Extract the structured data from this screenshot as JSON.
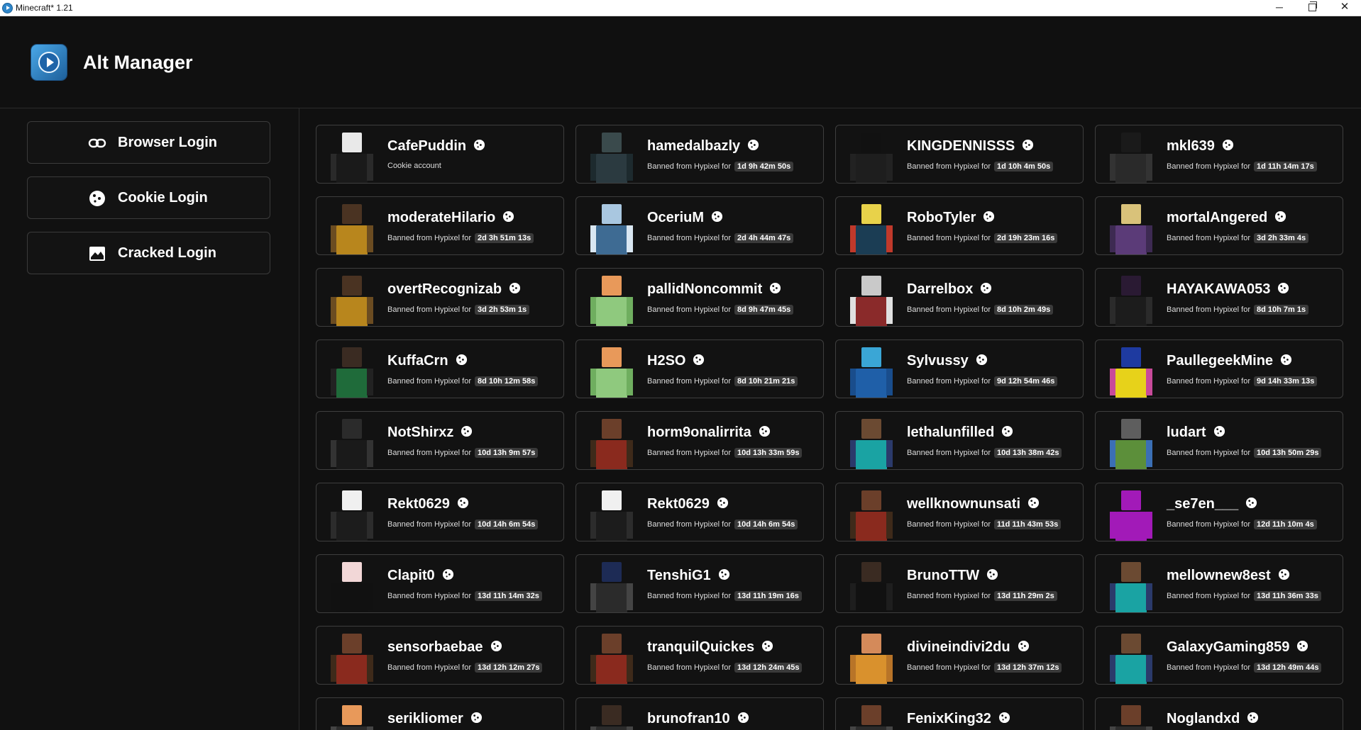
{
  "window": {
    "title": "Minecraft* 1.21",
    "controls": {
      "minimize": "─",
      "maximize": "",
      "close": "✕"
    }
  },
  "header": {
    "title": "Alt Manager",
    "logo_icon": "play-logo-icon"
  },
  "sidebar": {
    "buttons": [
      {
        "label": "Browser Login",
        "icon": "link-icon"
      },
      {
        "label": "Cookie Login",
        "icon": "cookie-icon"
      },
      {
        "label": "Cracked Login",
        "icon": "image-icon"
      }
    ]
  },
  "colors": {
    "background": "#101010",
    "card_border": "#3e3e3e",
    "badge": "#3a3a3a"
  },
  "banned_prefix": "Banned from Hypixel for",
  "accounts": [
    {
      "name": "CafePuddin",
      "status": "Cookie account",
      "duration": ""
    },
    {
      "name": "hamedalbazly",
      "status": "Banned from Hypixel for",
      "duration": "1d 9h 42m 50s"
    },
    {
      "name": "KINGDENNISSS",
      "status": "Banned from Hypixel for",
      "duration": "1d 10h 4m 50s"
    },
    {
      "name": "mkl639",
      "status": "Banned from Hypixel for",
      "duration": "1d 11h 14m 17s"
    },
    {
      "name": "moderateHilario",
      "status": "Banned from Hypixel for",
      "duration": "2d 3h 51m 13s"
    },
    {
      "name": "OceriuM",
      "status": "Banned from Hypixel for",
      "duration": "2d 4h 44m 47s"
    },
    {
      "name": "RoboTyler",
      "status": "Banned from Hypixel for",
      "duration": "2d 19h 23m 16s"
    },
    {
      "name": "mortalAngered",
      "status": "Banned from Hypixel for",
      "duration": "3d 2h 33m 4s"
    },
    {
      "name": "overtRecognizab",
      "status": "Banned from Hypixel for",
      "duration": "3d 2h 53m 1s"
    },
    {
      "name": "pallidNoncommit",
      "status": "Banned from Hypixel for",
      "duration": "8d 9h 47m 45s"
    },
    {
      "name": "Darrelbox",
      "status": "Banned from Hypixel for",
      "duration": "8d 10h 2m 49s"
    },
    {
      "name": "HAYAKAWA053",
      "status": "Banned from Hypixel for",
      "duration": "8d 10h 7m 1s"
    },
    {
      "name": "KuffaCrn",
      "status": "Banned from Hypixel for",
      "duration": "8d 10h 12m 58s"
    },
    {
      "name": "H2SO",
      "status": "Banned from Hypixel for",
      "duration": "8d 10h 21m 21s"
    },
    {
      "name": "Sylvussy",
      "status": "Banned from Hypixel for",
      "duration": "9d 12h 54m 46s"
    },
    {
      "name": "PaullegeekMine",
      "status": "Banned from Hypixel for",
      "duration": "9d 14h 33m 13s"
    },
    {
      "name": "NotShirxz",
      "status": "Banned from Hypixel for",
      "duration": "10d 13h 9m 57s"
    },
    {
      "name": "horm9onalirrita",
      "status": "Banned from Hypixel for",
      "duration": "10d 13h 33m 59s"
    },
    {
      "name": "lethalunfilled",
      "status": "Banned from Hypixel for",
      "duration": "10d 13h 38m 42s"
    },
    {
      "name": "ludart",
      "status": "Banned from Hypixel for",
      "duration": "10d 13h 50m 29s"
    },
    {
      "name": "Rekt0629",
      "status": "Banned from Hypixel for",
      "duration": "10d 14h 6m 54s"
    },
    {
      "name": "Rekt0629",
      "status": "Banned from Hypixel for",
      "duration": "10d 14h 6m 54s"
    },
    {
      "name": "wellknownunsati",
      "status": "Banned from Hypixel for",
      "duration": "11d 11h 43m 53s"
    },
    {
      "name": "_se7en___",
      "status": "Banned from Hypixel for",
      "duration": "12d 11h 10m 4s"
    },
    {
      "name": "Clapit0",
      "status": "Banned from Hypixel for",
      "duration": "13d 11h 14m 32s"
    },
    {
      "name": "TenshiG1",
      "status": "Banned from Hypixel for",
      "duration": "13d 11h 19m 16s"
    },
    {
      "name": "BrunoTTW",
      "status": "Banned from Hypixel for",
      "duration": "13d 11h 29m 2s"
    },
    {
      "name": "mellownew8est",
      "status": "Banned from Hypixel for",
      "duration": "13d 11h 36m 33s"
    },
    {
      "name": "sensorbaebae",
      "status": "Banned from Hypixel for",
      "duration": "13d 12h 12m 27s"
    },
    {
      "name": "tranquilQuickes",
      "status": "Banned from Hypixel for",
      "duration": "13d 12h 24m 45s"
    },
    {
      "name": "divineindivi2du",
      "status": "Banned from Hypixel for",
      "duration": "13d 12h 37m 12s"
    },
    {
      "name": "GalaxyGaming859",
      "status": "Banned from Hypixel for",
      "duration": "13d 12h 49m 44s"
    },
    {
      "name": "serikliomer",
      "status": "",
      "duration": ""
    },
    {
      "name": "brunofran10",
      "status": "",
      "duration": ""
    },
    {
      "name": "FenixKing32",
      "status": "",
      "duration": ""
    },
    {
      "name": "Noglandxd",
      "status": "",
      "duration": ""
    }
  ]
}
